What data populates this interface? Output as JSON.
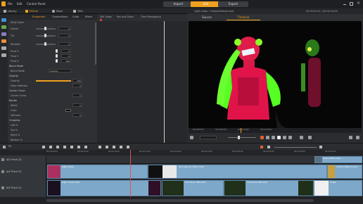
{
  "menu": {
    "items": [
      "File",
      "Edit",
      "Control Panel"
    ]
  },
  "top_buttons": {
    "import": "Import",
    "edit": "Edit",
    "export": "Export"
  },
  "tabs": [
    {
      "label": "Library"
    },
    {
      "label": "Effects"
    },
    {
      "label": "Mask"
    },
    {
      "label": "Title"
    }
  ],
  "subtabs": [
    "Properties",
    "Connections",
    "Color",
    "Effect"
  ],
  "properties": [
    {
      "label": "Dolly Zoom",
      "value": ""
    },
    {
      "label": "Swivel",
      "value": "0"
    },
    {
      "label": "Tilt",
      "value": "0"
    },
    {
      "label": "Rotation",
      "value": "0"
    },
    {
      "label": "Pivot X",
      "value": "0"
    },
    {
      "label": "Pivot Y",
      "value": "0"
    },
    {
      "label": "Pivot Z",
      "value": "100"
    },
    {
      "label": "Blend Mode",
      "value": ""
    },
    {
      "label": "Blend Mode",
      "value": "Overlay"
    },
    {
      "label": "Opacity",
      "value": ""
    },
    {
      "label": "Opacity",
      "value": "100"
    },
    {
      "label": "Edge Softness",
      "value": "0"
    },
    {
      "label": "Corner Curve",
      "value": ""
    },
    {
      "label": "Corner Curve",
      "value": "0"
    },
    {
      "label": "Border",
      "value": ""
    },
    {
      "label": "Width",
      "value": "0"
    },
    {
      "label": "Color",
      "value": ""
    },
    {
      "label": "Softness",
      "value": "0"
    },
    {
      "label": "Cropping",
      "value": ""
    },
    {
      "label": "Left %",
      "value": "0"
    },
    {
      "label": "Top %",
      "value": "0"
    },
    {
      "label": "Right %",
      "value": "0"
    },
    {
      "label": "Bottom %",
      "value": "0"
    }
  ],
  "keyframe_header": {
    "still_video": "Still Video",
    "pan_zoom": "Pan and Zoom",
    "time_remap": "Time Remapping"
  },
  "preview": {
    "title": "Light Leaks + BodyArtMovie.mp4",
    "timecode": "00:00:01:21 / 00:00:14:09",
    "tab_source": "Source",
    "tab_timeline": "Timeline"
  },
  "preview_ruler": [
    "00:00:00:00",
    "00:00:05:00",
    "00:00:10:00",
    "00:00:15:00"
  ],
  "timeline": {
    "fit_label": "Fit",
    "ruler": [
      "00:00:00:00",
      "00:00:05:00",
      "00:00:10:00",
      "00:00:15:00",
      "00:00:20:00",
      "00:00:25:00",
      "00:00:30:00",
      "00:00:35:00",
      "00:00:40:00",
      "00:00:45:00"
    ],
    "tracks": [
      {
        "label": "A/V Track (3)"
      },
      {
        "label": "A/V Track (2)"
      },
      {
        "label": "A/V Track (1)"
      }
    ],
    "clips": {
      "t1_right": "Glare Effect.mp4",
      "t2_a": "Light Leaks",
      "t2_b": "Dancing Girl Video.mp4",
      "t2_c": "Golden Ribbon.mp4",
      "t3_a": "Light Leaks.mp4",
      "t3_b": "The Show LED.mp4",
      "t3_c": "The Show LED.mp4",
      "t3_d": "Stage"
    }
  },
  "colors": {
    "accent": "#f0a020",
    "clip_blue": "#7ea8c9",
    "playhead": "#e05050"
  }
}
